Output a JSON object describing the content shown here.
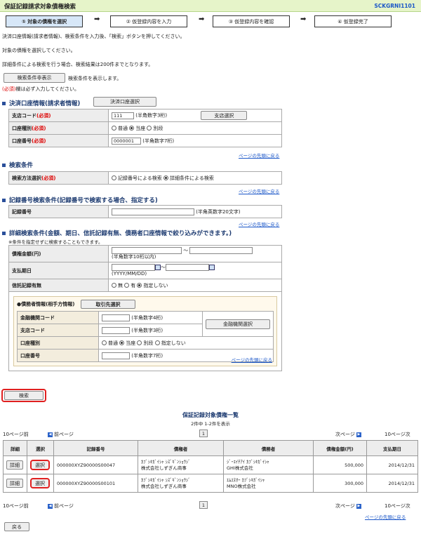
{
  "header": {
    "title": "保証記録請求対象債権検索",
    "screen_id": "SCKGRNI1101"
  },
  "steps": [
    "① 対象の債権を選択",
    "② 仮登録内容を入力",
    "③ 仮登録内容を確認",
    "④ 仮登録完了"
  ],
  "intro": [
    "決済口座情報(請求者情報)、検索条件を入力後、「検索」ボタンを押してください。",
    "対象の債権を選択してください。",
    "詳細条件による検索を行う場合、検索結果は200件までとなります。"
  ],
  "toggle": {
    "button": "検索条件非表示",
    "text": "検索条件を表示します。"
  },
  "required_note": {
    "mark": "(必須)",
    "text": "欄は必ず入力してください。"
  },
  "account": {
    "title": "決済口座情報(請求者情報)",
    "select_button": "決済口座選択",
    "branch_label": "支店コード",
    "branch_value": "111",
    "branch_hint": "(半角数字3桁)",
    "branch_button": "支店選択",
    "type_label": "口座種別",
    "type_opts": [
      "普通",
      "当座",
      "別段"
    ],
    "number_label": "口座番号",
    "number_value": "0000001",
    "number_hint": "(半角数字7桁)"
  },
  "req_tag": "(必須)",
  "back_to_top": "ページの先頭に戻る",
  "search_cond": {
    "title": "検索条件",
    "method_label": "検索方法選択",
    "opt1": "記録番号による検索",
    "opt2": "詳細条件による検索"
  },
  "record": {
    "title": "記録番号検索条件(記録番号で検索する場合、指定する)",
    "label": "記録番号",
    "hint": "(半角英数字20文字)"
  },
  "detail": {
    "title": "詳細検索条件(金額、期日、信託記録有無、債務者口座情報で絞り込みができます。)",
    "note": "※条件を指定せずに検索することもできます。",
    "amount_label": "債権金額(円)",
    "amount_hint": "(半角数字10桁以内)",
    "tilde": "〜",
    "due_label": "支払期日",
    "due_hint": "(YYYY/MM/DD)",
    "trust_label": "信託記録有無",
    "trust_opts": [
      "無",
      "有",
      "指定しない"
    ],
    "debtor_title": "●債務者情報(相手方情報)",
    "partner_button": "取引先選択",
    "bank_label": "金融機関コード",
    "bank_hint": "(半角数字4桁)",
    "bank_button": "金融機関選択",
    "branch_label": "支店コード",
    "branch_hint": "(半角数字3桁)",
    "type_label": "口座種別",
    "type_opts": [
      "普通",
      "当座",
      "別段",
      "指定しない"
    ],
    "number_label": "口座番号",
    "number_hint": "(半角数字7桁)"
  },
  "search_button": "検索",
  "results": {
    "title": "保証記録対象債権一覧",
    "count": "2件中 1-2件を表示",
    "prev10": "10ページ前",
    "prev": "前ページ",
    "page": "1",
    "next": "次ページ",
    "next10": "10ページ次",
    "headers": [
      "詳細",
      "選択",
      "記録番号",
      "債権者",
      "債務者",
      "債権金額(円)",
      "支払期日"
    ],
    "rows": [
      {
        "detail": "詳細",
        "select": "選択",
        "record": "000000XYZ90000S00047",
        "creditor1": "ｶﾌﾞｼｷｶﾞｲｼｬ ｼｽﾞｷﾞﾝｼｮｳｼﾞ",
        "creditor2": "株式会社しずぎん商事",
        "debtor1": "ｼﾞｰｴｲﾁｱｲ ｶﾌﾞｼｷｶﾞｲｼｬ",
        "debtor2": "GHI株式会社",
        "amount": "500,000",
        "due": "2014/12/31"
      },
      {
        "detail": "詳細",
        "select": "選択",
        "record": "000000XYZ90000S00101",
        "creditor1": "ｶﾌﾞｼｷｶﾞｲｼｬ ｼｽﾞｷﾞﾝｼｮｳｼﾞ",
        "creditor2": "株式会社しずぎん商事",
        "debtor1": "ｴﾑｴﾇｵｰ ｶﾌﾞｼｷｶﾞｲｼｬ",
        "debtor2": "MNO株式会社",
        "amount": "300,000",
        "due": "2014/12/31"
      }
    ]
  },
  "back_button": "戻る"
}
